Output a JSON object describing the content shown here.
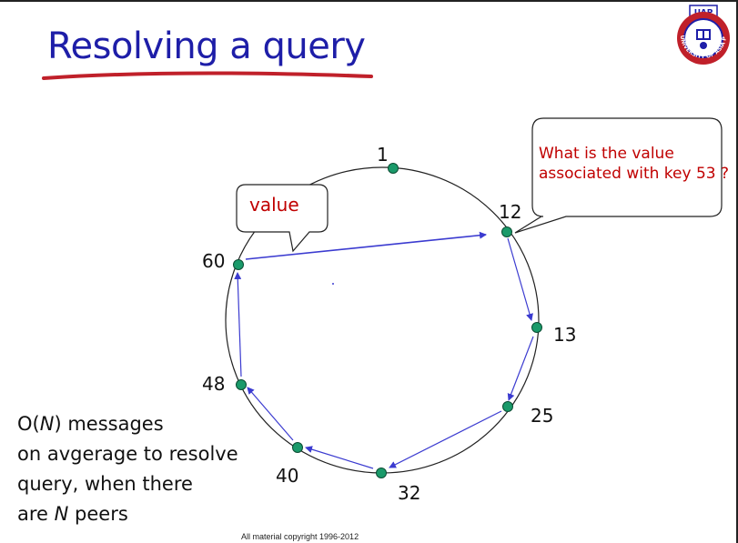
{
  "slide": {
    "title": "Resolving a query",
    "footer": "All material copyright 1996-2012"
  },
  "logo": {
    "top_text": "UAP",
    "ring_text": "UNIVERSITY OF ASIA PACIFIC"
  },
  "diagram": {
    "nodes": [
      {
        "id": "1",
        "label": "1"
      },
      {
        "id": "12",
        "label": "12"
      },
      {
        "id": "13",
        "label": "13"
      },
      {
        "id": "25",
        "label": "25"
      },
      {
        "id": "32",
        "label": "32"
      },
      {
        "id": "40",
        "label": "40"
      },
      {
        "id": "48",
        "label": "48"
      },
      {
        "id": "60",
        "label": "60"
      }
    ],
    "query_bubble": {
      "line1": "What is the value",
      "line2": "associated with key 53 ?"
    },
    "value_bubble": {
      "text": "value"
    }
  },
  "note": {
    "line1_prefix": "O(",
    "line1_var": "N",
    "line1_suffix": ") messages",
    "line2": "on avgerage to resolve",
    "line3": "query, when there",
    "line4_prefix": "are ",
    "line4_var": "N",
    "line4_suffix": " peers"
  },
  "colors": {
    "title": "#1e1ea8",
    "node_fill": "#1a9a6a",
    "arrow": "#3b3bd0",
    "bubble_text": "#c00000",
    "underline": "#c0202a"
  }
}
